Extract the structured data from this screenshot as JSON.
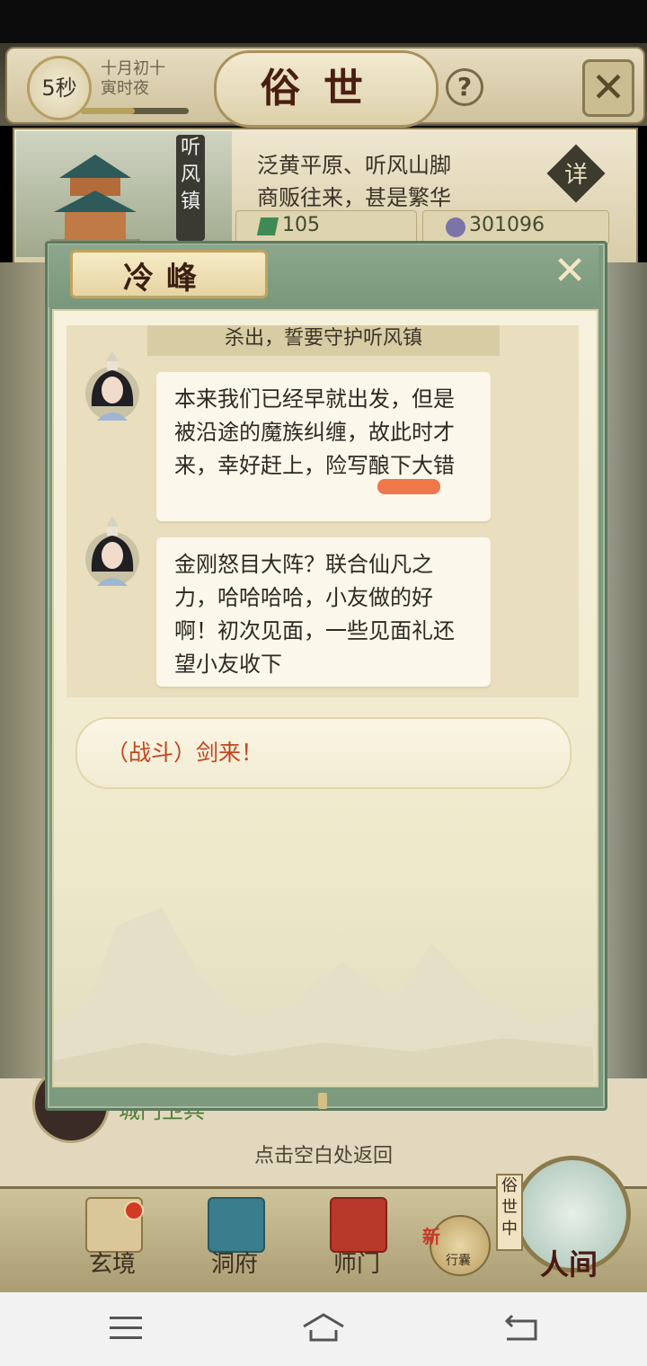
{
  "header": {
    "timer": "5秒",
    "date": [
      "十月初十",
      "寅时夜"
    ],
    "title": "俗世",
    "help_icon": "?",
    "close_icon": "✕"
  },
  "location": {
    "name_sign": [
      "听",
      "风",
      "镇"
    ],
    "description": [
      "泛黄平原、听风山脚",
      "商贩往来，甚是繁华"
    ],
    "detail_button": "详",
    "stat_jade": "105",
    "stat_coin": "301096"
  },
  "dialog": {
    "title": "冷峰",
    "close_icon": "✕",
    "prev_line": "杀出，誓要守护听风镇",
    "messages": [
      {
        "speaker_avatar": "avatar-lengfeng",
        "text": "本来我们已经早就出发，但是被沿途的魔族纠缠，故此时才来，幸好赶上，险写酿下大错"
      },
      {
        "speaker_avatar": "avatar-lengfeng",
        "text": "金刚怒目大阵？联合仙凡之力，哈哈哈哈，小友做的好啊！初次见面，一些见面礼还望小友收下"
      }
    ],
    "option": "（战斗）剑来！"
  },
  "background": {
    "guard_label": "城门卫兵",
    "back_hint": "点击空白处返回"
  },
  "bottom_nav": {
    "items": [
      {
        "label": "玄境",
        "icon": "scroll-icon"
      },
      {
        "label": "洞府",
        "icon": "pavilion-icon"
      },
      {
        "label": "师门",
        "icon": "banner-icon"
      }
    ],
    "xingnang_label": "行囊",
    "xingnang_badge": "新",
    "renjian_label": "人间",
    "sushi_tag": [
      "俗",
      "世",
      "中"
    ]
  },
  "colors": {
    "dialog_frame": "#7d9a7e",
    "paper": "#f6f1dd",
    "option_text": "#c1461e",
    "highlight": "#f0764c",
    "title_text": "#4a1f12"
  }
}
